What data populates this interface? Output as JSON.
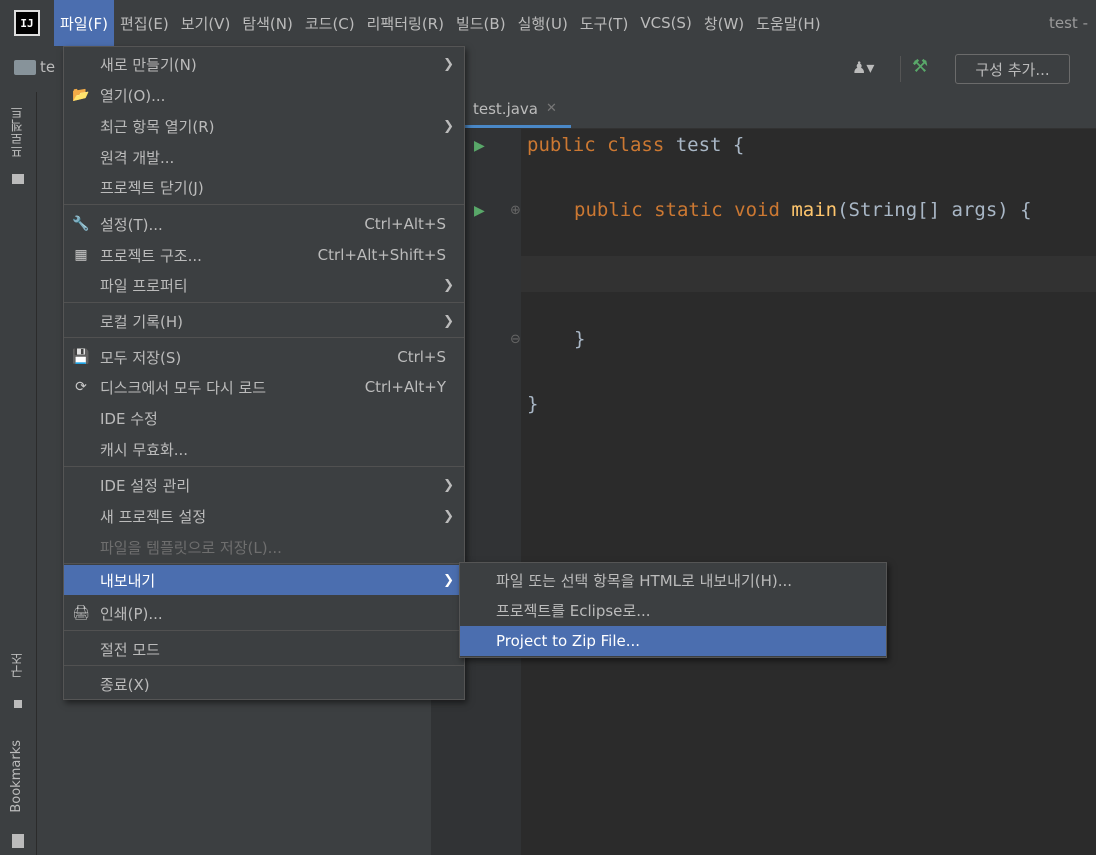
{
  "menubar": {
    "logo": "IJ",
    "items": [
      "파일(F)",
      "편집(E)",
      "보기(V)",
      "탐색(N)",
      "코드(C)",
      "리팩터링(R)",
      "빌드(B)",
      "실행(U)",
      "도구(T)",
      "VCS(S)",
      "창(W)",
      "도움말(H)"
    ],
    "title": "test -"
  },
  "toolbar": {
    "project_crumb": "te",
    "config_button": "구성 추가..."
  },
  "sidebar": {
    "project_label": "프로젝트",
    "structure_label": "구조",
    "bookmarks_label": "Bookmarks"
  },
  "editor": {
    "tab": "test.java",
    "lines": {
      "l1_kw": "public class ",
      "l1_rest": "test {",
      "l2_kw": "public static void ",
      "l2_fn": "main",
      "l2_rest": "(String[] args) {",
      "l3": "}",
      "l4": "}"
    }
  },
  "file_menu": {
    "new": "새로 만들기(N)",
    "open": "열기(O)...",
    "recent": "최근 항목 열기(R)",
    "remote": "원격 개발...",
    "close_project": "프로젝트 닫기(J)",
    "settings": "설정(T)...",
    "settings_shortcut": "Ctrl+Alt+S",
    "project_structure": "프로젝트 구조...",
    "project_structure_shortcut": "Ctrl+Alt+Shift+S",
    "file_properties": "파일 프로퍼티",
    "local_history": "로컬 기록(H)",
    "save_all": "모두 저장(S)",
    "save_all_shortcut": "Ctrl+S",
    "reload_all": "디스크에서 모두 다시 로드",
    "reload_all_shortcut": "Ctrl+Alt+Y",
    "ide_repair": "IDE 수정",
    "invalidate_caches": "캐시 무효화...",
    "manage_ide_settings": "IDE 설정 관리",
    "new_project_settings": "새 프로젝트 설정",
    "save_as_template": "파일을 템플릿으로 저장(L)...",
    "export": "내보내기",
    "print": "인쇄(P)...",
    "power_save": "절전 모드",
    "exit": "종료(X)"
  },
  "export_submenu": {
    "html": "파일 또는 선택 항목을 HTML로 내보내기(H)...",
    "eclipse": "프로젝트를 Eclipse로...",
    "zip": "Project to Zip File..."
  }
}
